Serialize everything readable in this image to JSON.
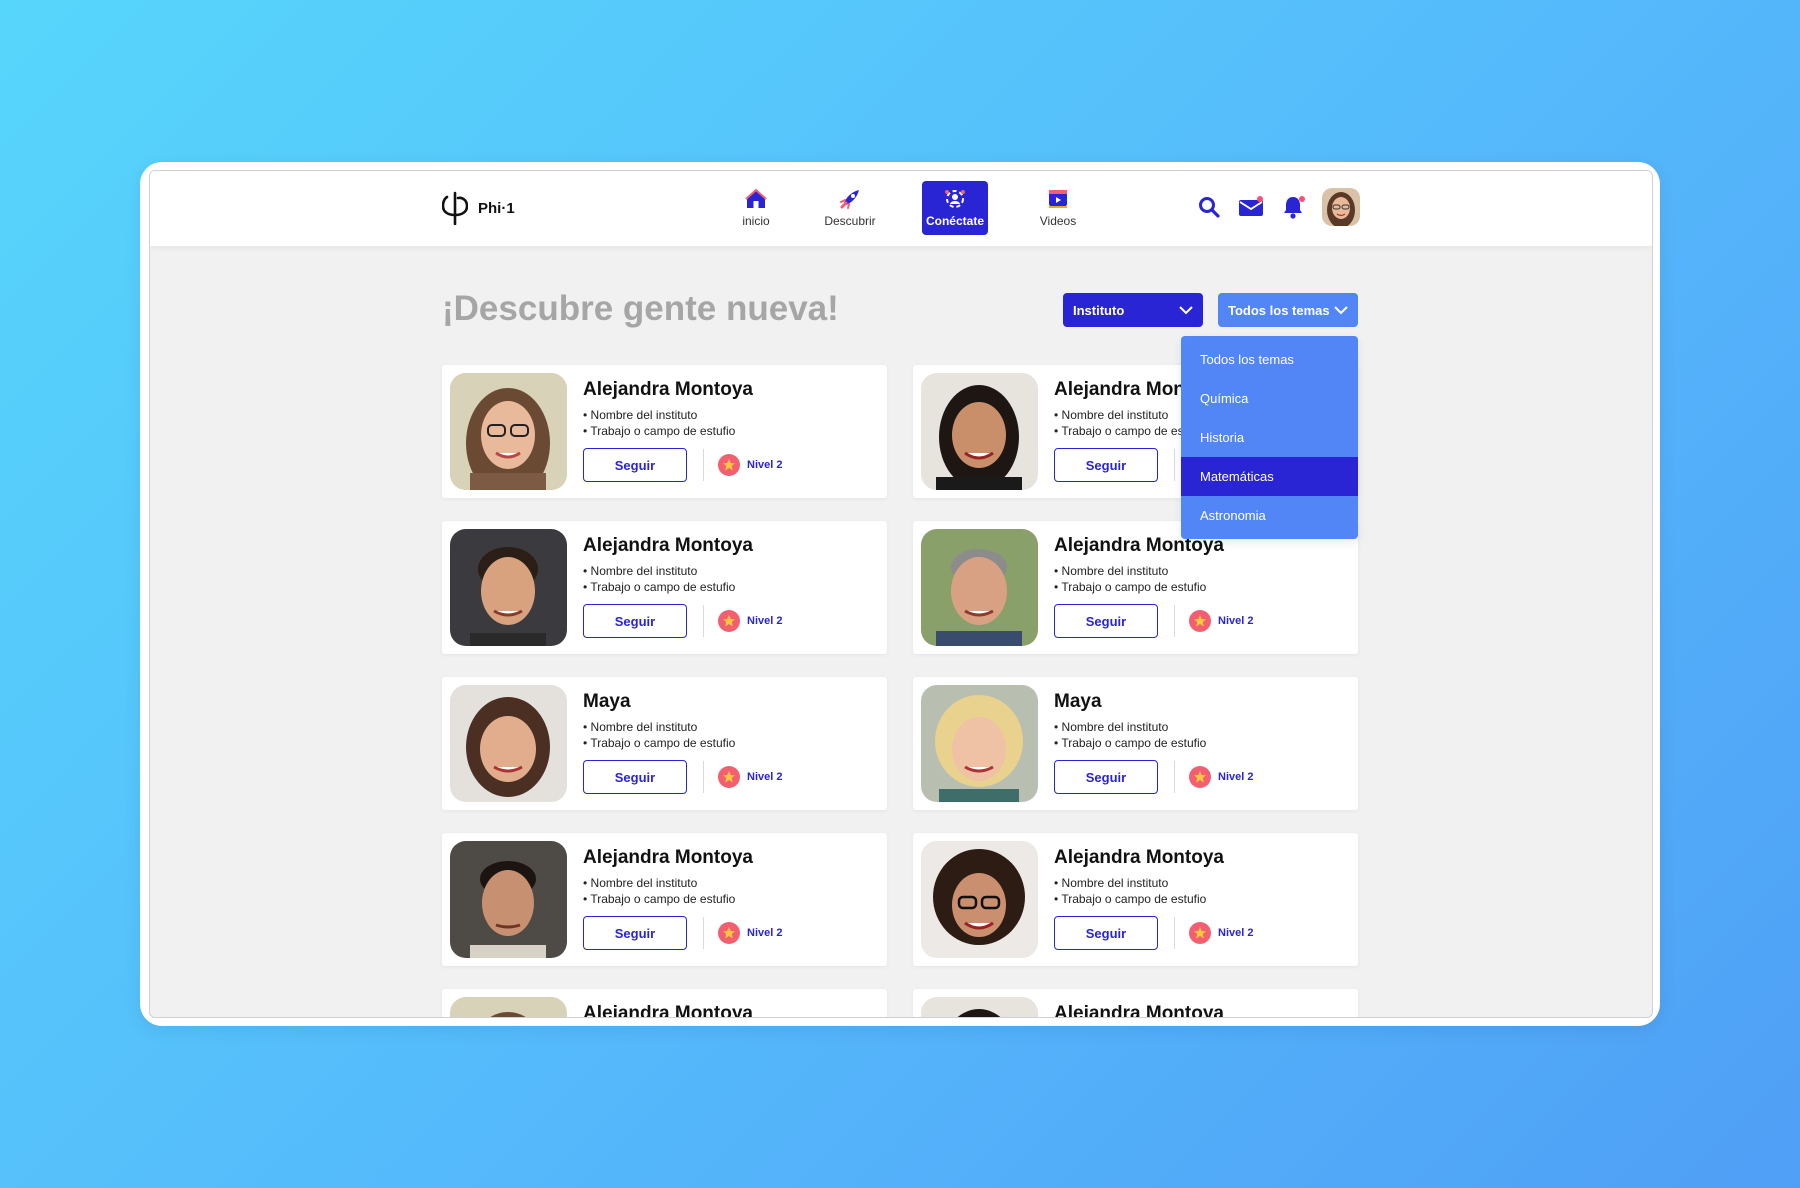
{
  "app": {
    "name": "Phi·1"
  },
  "nav": [
    {
      "label": "inicio",
      "icon": "home-icon"
    },
    {
      "label": "Descubrir",
      "icon": "rocket-icon"
    },
    {
      "label": "Conéctate",
      "icon": "connect-people-icon",
      "active": true
    },
    {
      "label": "Videos",
      "icon": "video-icon"
    }
  ],
  "page": {
    "title": "¡Descubre gente nueva!"
  },
  "filters": {
    "institute": {
      "label": "Instituto"
    },
    "topics": {
      "label": "Todos los temas",
      "options": [
        "Todos los temas",
        "Química",
        "Historia",
        "Matemáticas",
        "Astronomia"
      ],
      "highlighted": "Matemáticas"
    }
  },
  "card_common": {
    "line1": "• Nombre del instituto",
    "line2": "• Trabajo o campo de estufio",
    "follow_label": "Seguir",
    "level_label": "Nivel 2"
  },
  "people": [
    {
      "name": "Alejandra Montoya"
    },
    {
      "name": "Alejandra Montoya"
    },
    {
      "name": "Alejandra Montoya"
    },
    {
      "name": "Alejandra Montoya"
    },
    {
      "name": "Maya"
    },
    {
      "name": "Maya"
    },
    {
      "name": "Alejandra Montoya"
    },
    {
      "name": "Alejandra Montoya"
    },
    {
      "name": "Alejandra Montoya"
    },
    {
      "name": "Alejandra Montoya"
    }
  ],
  "colors": {
    "primary": "#2a25d4",
    "secondary": "#5286f7",
    "level_badge": "#f35f70",
    "heading_gray": "#a6a6a6"
  }
}
